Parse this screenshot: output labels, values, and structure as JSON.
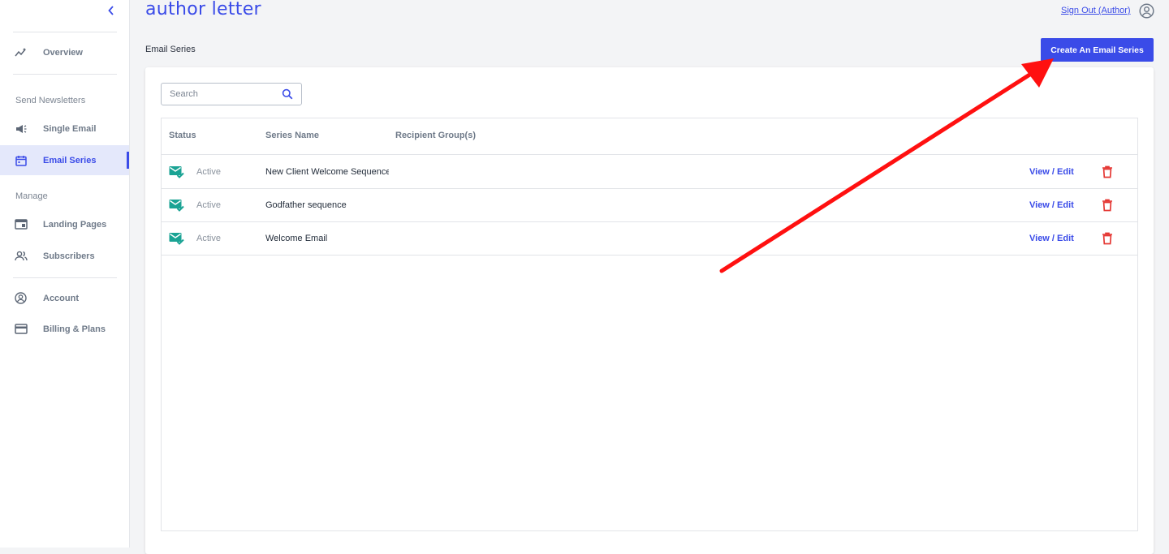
{
  "app": {
    "logo_text": "author letter",
    "accent_color": "#3a4be8",
    "danger_color": "#e53935",
    "success_color": "#1aa394"
  },
  "sidebar": {
    "collapse_icon": "chevron-left-icon",
    "overview": {
      "label": "Overview",
      "icon": "sparkline-icon"
    },
    "section_send": "Send Newsletters",
    "single_email": {
      "label": "Single Email",
      "icon": "megaphone-icon"
    },
    "email_series": {
      "label": "Email Series",
      "icon": "calendar-icon",
      "active": true
    },
    "section_manage": "Manage",
    "landing_pages": {
      "label": "Landing Pages",
      "icon": "browser-window-icon"
    },
    "subscribers": {
      "label": "Subscribers",
      "icon": "people-icon"
    },
    "account": {
      "label": "Account",
      "icon": "user-circle-icon"
    },
    "billing": {
      "label": "Billing & Plans",
      "icon": "credit-card-icon"
    }
  },
  "header": {
    "sign_out_label": "Sign Out (Author)",
    "page_title": "Email Series",
    "create_button_label": "Create An Email Series"
  },
  "search": {
    "placeholder": "Search",
    "value": ""
  },
  "table": {
    "headers": {
      "status": "Status",
      "series_name": "Series Name",
      "recipient_groups": "Recipient Group(s)"
    },
    "rows": [
      {
        "status": "Active",
        "name": "New Client Welcome Sequence",
        "recipients": "",
        "action": "View / Edit"
      },
      {
        "status": "Active",
        "name": "Godfather sequence",
        "recipients": "",
        "action": "View / Edit"
      },
      {
        "status": "Active",
        "name": "Welcome Email",
        "recipients": "",
        "action": "View / Edit"
      }
    ]
  }
}
